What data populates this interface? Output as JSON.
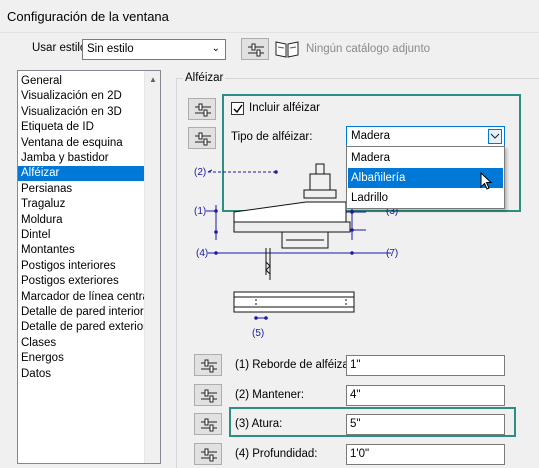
{
  "window": {
    "title": "Configuración de la ventana"
  },
  "style_row": {
    "label": "Usar estilo:",
    "value": "Sin estilo",
    "catalog_text": "Ningún catálogo adjunto"
  },
  "categories": [
    "General",
    "Visualización en 2D",
    "Visualización en 3D",
    "Etiqueta de ID",
    "Ventana de esquina",
    "Jamba y bastidor",
    "Alféizar",
    "Persianas",
    "Tragaluz",
    "Moldura",
    "Dintel",
    "Montantes",
    "Postigos interiores",
    "Postigos exteriores",
    "Marcador de línea central",
    "Detalle de pared interior",
    "Detalle de pared exterior",
    "Clases",
    "Energos",
    "Datos"
  ],
  "selected_category": "Alféizar",
  "group_title": "Alféizar",
  "include_sill": {
    "label": "Incluir alféizar",
    "checked": true
  },
  "sill_type": {
    "label": "Tipo de alféizar:",
    "value": "Madera",
    "options": [
      "Madera",
      "Albañilería",
      "Ladrillo"
    ],
    "highlighted": "Albañilería"
  },
  "diagram_labels": {
    "l1": "(1)",
    "l2": "(2)",
    "l3": "(3)",
    "l4": "(4)",
    "l5": "(5)",
    "l7": "(7)"
  },
  "fields": [
    {
      "label": "(1) Reborde de alféizar:",
      "value": "1\""
    },
    {
      "label": "(2) Mantener:",
      "value": "4\""
    },
    {
      "label": "(3) Atura:",
      "value": "5\""
    },
    {
      "label": "(4) Profundidad:",
      "value": "1'0\""
    }
  ],
  "colors": {
    "accent_frame": "#2b8f84",
    "selection": "#0078d7",
    "dimension_blue": "#1a1aa6"
  }
}
